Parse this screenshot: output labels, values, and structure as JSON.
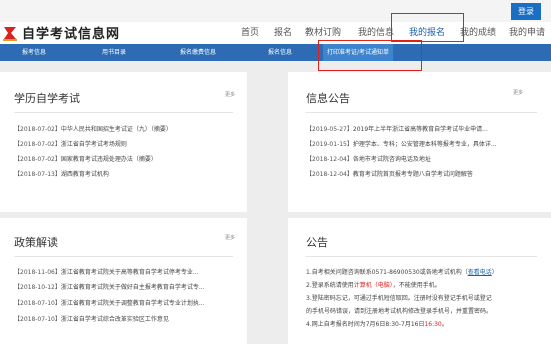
{
  "topbar": {
    "login_label": "登录"
  },
  "header": {
    "site_title": "自学考试信息网",
    "nav": [
      "首页",
      "报名",
      "教材订购",
      "我的信息",
      "我的报名",
      "我的成绩",
      "我的申请"
    ]
  },
  "subnav": [
    "报考信息",
    "用书目录",
    "报名缴费信息",
    "报名信息",
    "打印准考证/考试通知单"
  ],
  "panels": {
    "exam": {
      "title": "学历自学考试",
      "more": "更多",
      "items": [
        {
          "date": "【2018-07-02】",
          "text": "中华人民共和国招生考试证（九）（摘要）"
        },
        {
          "date": "【2018-07-02】",
          "text": "浙江省自学考试考场规则"
        },
        {
          "date": "【2018-07-02】",
          "text": "国家教育考试违规处理办法（摘要）"
        },
        {
          "date": "【2018-07-13】",
          "text": "湖西教育考试机构"
        }
      ]
    },
    "notice": {
      "title": "信息公告",
      "more": "更多",
      "items": [
        {
          "date": "【2019-05-27】",
          "text": "2019年上半年浙江省高等教育自学考试毕业申请..."
        },
        {
          "date": "【2019-01-15】",
          "text": "护理学本、专科；公安管理本科等报考专业，具体详..."
        },
        {
          "date": "【2018-12-04】",
          "text": "各地市考试院咨询电话及地址"
        },
        {
          "date": "【2018-12-04】",
          "text": "教育考试院首页报考专题八自学考试问题解答"
        }
      ]
    },
    "policy": {
      "title": "政策解读",
      "more": "更多",
      "items": [
        {
          "date": "【2018-11-06】",
          "text": "浙江省教育考试院关于高等教育自学考试停考专业..."
        },
        {
          "date": "【2018-10-12】",
          "text": "浙江省教育考试院关于做好自主报考教育自学考试专..."
        },
        {
          "date": "【2018-07-10】",
          "text": "浙江省教育考试院关于调整教育自学考试专业计划执..."
        },
        {
          "date": "【2018-07-10】",
          "text": "浙江省自学考试综合改革实验区工作意见"
        }
      ]
    },
    "announce": {
      "title": "公告",
      "lines": [
        {
          "parts": [
            {
              "t": "1.自考相关问题咨询联系0571-86900530或各地考试机构（",
              "c": ""
            },
            {
              "t": "查看电话",
              "c": "blue"
            },
            {
              "t": "）",
              "c": ""
            }
          ]
        },
        {
          "parts": [
            {
              "t": "2.登录系统请使用",
              "c": ""
            },
            {
              "t": "计算机（电脑）",
              "c": "red"
            },
            {
              "t": "，不能使用手机。",
              "c": ""
            }
          ]
        },
        {
          "parts": [
            {
              "t": "3.登陆密码忘记，可通过手机短信取回。注册时没有登记手机号或登记",
              "c": ""
            }
          ]
        },
        {
          "parts": [
            {
              "t": "   的手机号码错误，请到注册地考试机构修改登录手机号，并重置密码。",
              "c": ""
            }
          ]
        },
        {
          "parts": [
            {
              "t": "4.网上自考报名时间为7月6日8:30-7月16日",
              "c": ""
            },
            {
              "t": "16:30",
              "c": "red"
            },
            {
              "t": "。",
              "c": ""
            }
          ]
        }
      ]
    }
  }
}
